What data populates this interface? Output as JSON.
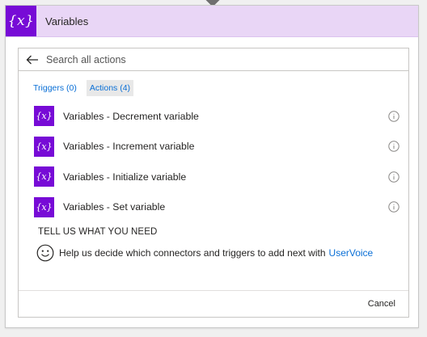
{
  "card": {
    "title": "Variables",
    "icon": "variables-icon",
    "icon_glyph": "{x}",
    "accent_color": "#770bd6",
    "header_bg": "#e9d6f6"
  },
  "search": {
    "placeholder": "Search all actions",
    "value": ""
  },
  "tabs": [
    {
      "label": "Triggers (0)",
      "active": false
    },
    {
      "label": "Actions (4)",
      "active": true
    }
  ],
  "actions": [
    {
      "label": "Variables - Decrement variable",
      "icon_glyph": "{x}"
    },
    {
      "label": "Variables - Increment variable",
      "icon_glyph": "{x}"
    },
    {
      "label": "Variables - Initialize variable",
      "icon_glyph": "{x}"
    },
    {
      "label": "Variables - Set variable",
      "icon_glyph": "{x}"
    }
  ],
  "feedback": {
    "title": "TELL US WHAT YOU NEED",
    "text": "Help us decide which connectors and triggers to add next with",
    "link": "UserVoice",
    "link_color": "#0a6fd6"
  },
  "footer": {
    "cancel_label": "Cancel"
  }
}
